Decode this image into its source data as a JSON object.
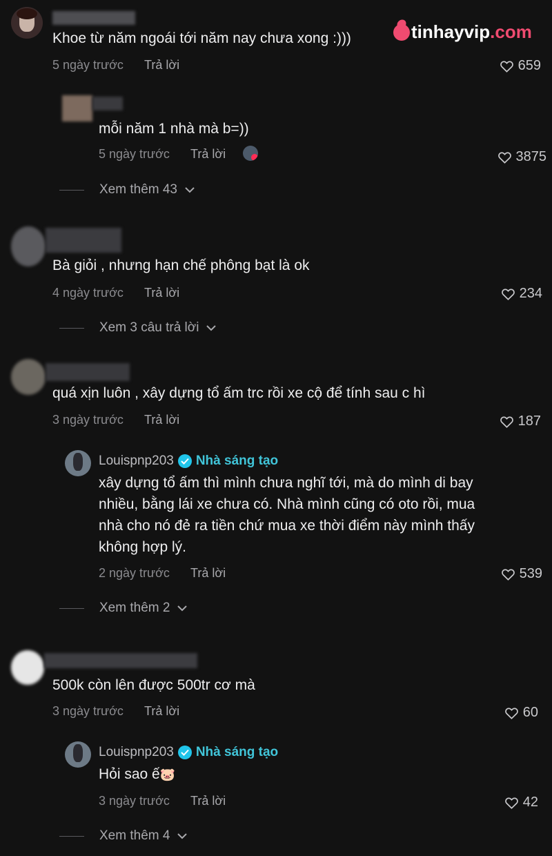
{
  "watermark": {
    "brand": "tinhayvip",
    "domain": ".com"
  },
  "comments": [
    {
      "text": "Khoe từ năm ngoái tới năm nay chưa xong :)))",
      "time": "5 ngày trước",
      "reply": "Trả lời",
      "likes": "659",
      "replies": [
        {
          "text": "mỗi năm 1 nhà mà b=))",
          "time": "5 ngày trước",
          "reply": "Trả lời",
          "likes": "3875"
        }
      ],
      "more": "Xem thêm 43"
    },
    {
      "text": "Bà giỏi , nhưng hạn chế phông bạt là ok",
      "time": "4 ngày trước",
      "reply": "Trả lời",
      "likes": "234",
      "more": "Xem 3 câu trả lời"
    },
    {
      "text": "quá xịn luôn , xây dựng tổ ấm trc rồi xe cộ để tính sau c hì",
      "time": "3 ngày trước",
      "reply": "Trả lời",
      "likes": "187",
      "replies": [
        {
          "username": "Louispnp203",
          "badge": "Nhà sáng tạo",
          "text": "xây dựng tổ ấm thì mình chưa nghĩ tới, mà do mình di bay nhiều, bằng lái xe chưa có. Nhà mình cũng có oto rồi, mua nhà cho nó đẻ ra tiền chứ mua xe thời điểm này mình thấy không hợp lý.",
          "time": "2 ngày trước",
          "reply": "Trả lời",
          "likes": "539"
        }
      ],
      "more": "Xem thêm 2"
    },
    {
      "text": "500k còn lên được 500tr cơ mà",
      "time": "3 ngày trước",
      "reply": "Trả lời",
      "likes": "60",
      "replies": [
        {
          "username": "Louispnp203",
          "badge": "Nhà sáng tạo",
          "text": "Hỏi sao ế",
          "emoji": "🐷",
          "time": "3 ngày trước",
          "reply": "Trả lời",
          "likes": "42"
        }
      ],
      "more": "Xem thêm 4"
    }
  ]
}
